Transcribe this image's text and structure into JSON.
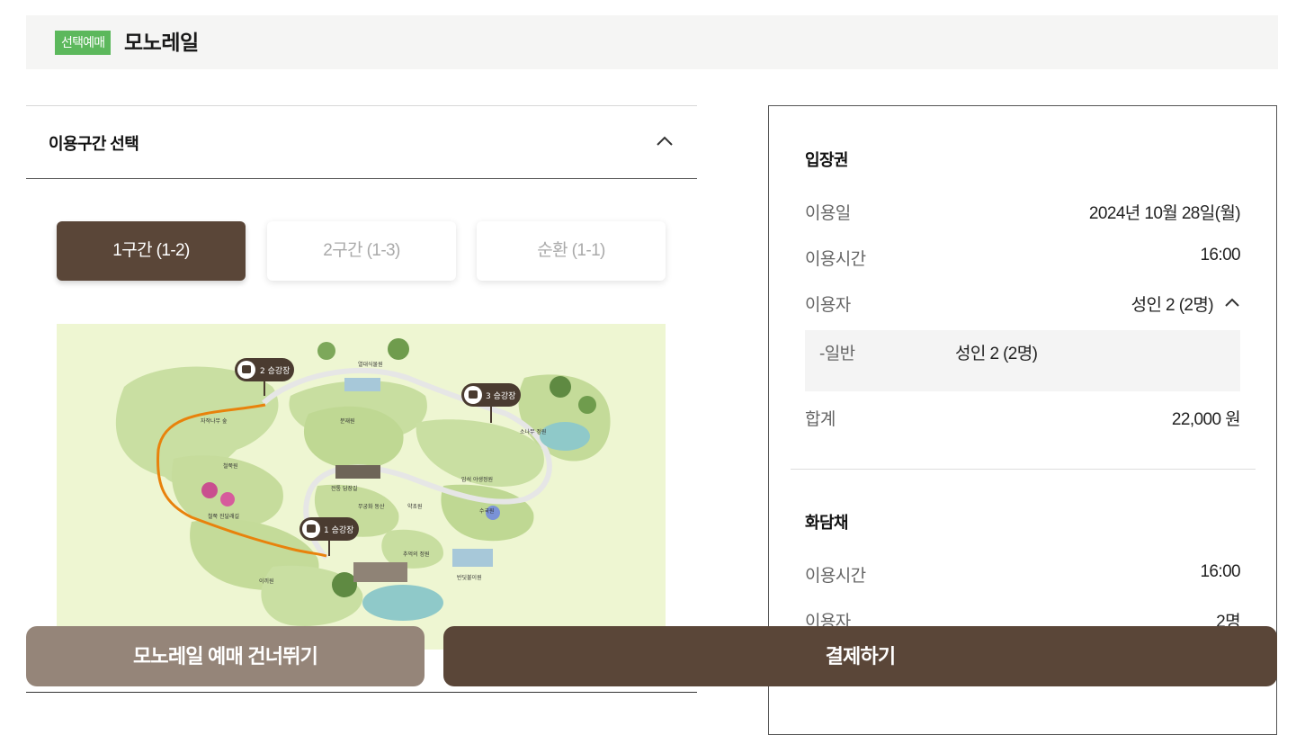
{
  "header": {
    "badge": "선택예매",
    "title": "모노레일"
  },
  "section": {
    "title": "이용구간 선택"
  },
  "segments": [
    {
      "label": "1구간 (1-2)",
      "active": true
    },
    {
      "label": "2구간 (1-3)",
      "active": false
    },
    {
      "label": "순환 (1-1)",
      "active": false
    }
  ],
  "map": {
    "stations": [
      {
        "label": "2 승강장"
      },
      {
        "label": "3 승강장"
      },
      {
        "label": "1 승강장"
      }
    ],
    "areas": [
      "열대식물원",
      "자작나무 숲",
      "분재원",
      "소나무 정원",
      "철쭉원",
      "철쭉 진달래길",
      "전통 담장길",
      "무궁화 동산",
      "약초원",
      "수국원",
      "이끼원",
      "추억의 정원",
      "반딧불이원",
      "암석 야생정원"
    ]
  },
  "summary": {
    "ticket": {
      "title": "입장권",
      "date_label": "이용일",
      "date_value": "2024년 10월 28일(월)",
      "time_label": "이용시간",
      "time_value": "16:00",
      "user_label": "이용자",
      "user_value": "성인 2 (2명)",
      "detail_label": "-일반",
      "detail_value": "성인 2 (2명)",
      "total_label": "합계",
      "total_value": "22,000 원"
    },
    "monorail": {
      "title": "화담채",
      "time_label": "이용시간",
      "time_value": "16:00",
      "user_label": "이용자",
      "user_value": "2명"
    }
  },
  "buttons": {
    "skip": "모노레일 예매 건너뛰기",
    "pay": "결제하기"
  },
  "colors": {
    "brand_brown": "#5a4638",
    "muted_brown": "#958579",
    "badge_green": "#5cb85c",
    "route_orange": "#e8820c",
    "map_bg": "#eef6d2"
  }
}
